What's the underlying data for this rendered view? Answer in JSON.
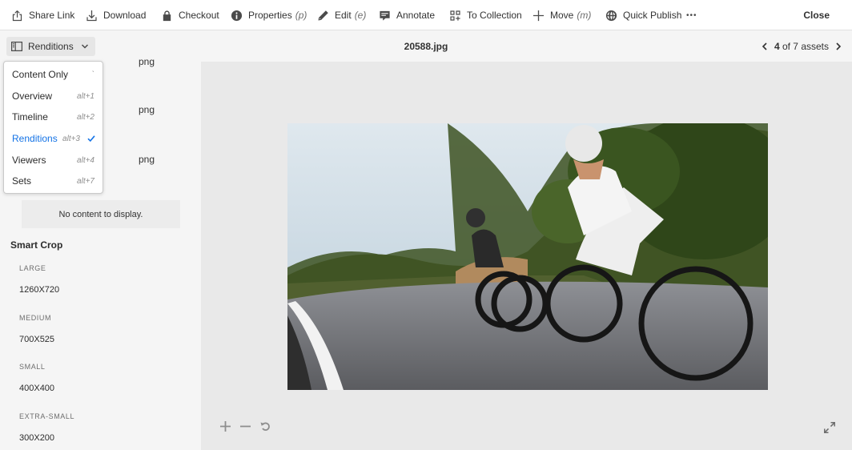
{
  "toolbar": {
    "share_link": "Share Link",
    "download": "Download",
    "checkout": "Checkout",
    "properties": "Properties",
    "properties_key": "(p)",
    "edit": "Edit",
    "edit_key": "(e)",
    "annotate": "Annotate",
    "to_collection": "To Collection",
    "move": "Move",
    "move_key": "(m)",
    "quick_publish": "Quick Publish",
    "more": "•••",
    "close": "Close"
  },
  "header": {
    "rail_toggle_label": "Renditions",
    "asset_title": "20588.jpg",
    "pager_current": "4",
    "pager_rest": "of 7 assets"
  },
  "menu": {
    "items": [
      {
        "label": "Content Only",
        "shortcut": "`"
      },
      {
        "label": "Overview",
        "shortcut": "alt+1"
      },
      {
        "label": "Timeline",
        "shortcut": "alt+2"
      },
      {
        "label": "Renditions",
        "shortcut": "alt+3",
        "selected": true
      },
      {
        "label": "Viewers",
        "shortcut": "alt+4"
      },
      {
        "label": "Sets",
        "shortcut": "alt+7"
      }
    ]
  },
  "rail": {
    "renditions": [
      {
        "ext": "png"
      },
      {
        "ext": "png"
      },
      {
        "ext": "png"
      }
    ],
    "no_content": "No content to display.",
    "smart_crop_title": "Smart Crop",
    "smart_crop": [
      {
        "label": "LARGE",
        "size": "1260X720"
      },
      {
        "label": "MEDIUM",
        "size": "700X525"
      },
      {
        "label": "SMALL",
        "size": "400X400"
      },
      {
        "label": "EXTRA-SMALL",
        "size": "300X200"
      }
    ]
  },
  "colors": {
    "accent": "#1473e6",
    "rail_bg": "#f5f5f5",
    "viewer_bg": "#e9e9e9"
  }
}
